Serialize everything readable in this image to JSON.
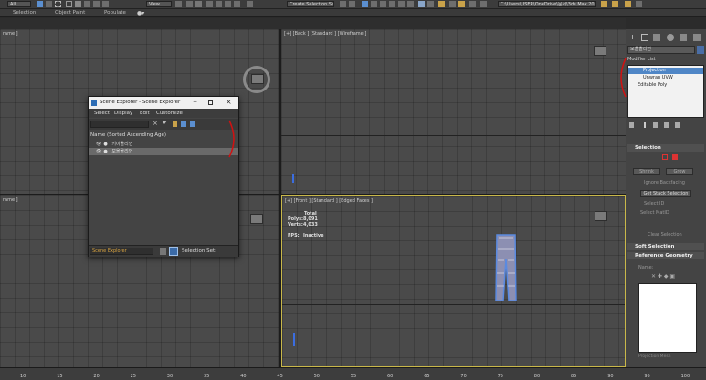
{
  "toolbar": {
    "all_dropdown": "All",
    "view_dropdown": "View",
    "selection_set_dropdown": "Create Selection Se",
    "project_path": "C:\\Users\\USER\\OneDrive\\문서\\3ds Max 2022"
  },
  "ribbon": {
    "tabs": [
      "Selection",
      "Object Paint",
      "Populate"
    ]
  },
  "viewports": {
    "top_left_label": "rame ]",
    "top_right_label": "[+] [Back ] [Standard ] [Wireframe ]",
    "bottom_left_label": "rame ]",
    "bottom_right_label": "[+] [Front ] [Standard ] [Edged Faces ]",
    "stats": {
      "total_label": "Total",
      "polys_label": "Polys:",
      "polys_value": "8,091",
      "verts_label": "Verts:",
      "verts_value": "4,033",
      "fps_label": "FPS:",
      "fps_value": "Inactive"
    }
  },
  "scene_explorer": {
    "title": "Scene Explorer - Scene Explorer",
    "menus": [
      "Select",
      "Display",
      "Edit",
      "Customize"
    ],
    "column_header": "Name (Sorted Ascending Age)",
    "rows": [
      {
        "label": "키이올리언"
      },
      {
        "label": "모올올리언"
      }
    ],
    "explorer_dropdown": "Scene Explorer",
    "selection_set_label": "Selection Set:"
  },
  "command_panel": {
    "object_name": "모올올리언",
    "modifier_list_label": "Modifier List",
    "modifier_stack": [
      {
        "label": "Projection",
        "selected": true
      },
      {
        "label": "Unwrap UVW",
        "selected": false
      },
      {
        "label": "Editable Poly",
        "selected": false
      }
    ],
    "selection_rollout": "Selection",
    "shrink_label": "Shrink",
    "grow_label": "Grow",
    "ignore_backfacing_label": "Ignore Backfacing",
    "get_stack_selection_label": "Get Stack Selection",
    "select_id_label": "Select ID",
    "select_matid_label": "Select MatID",
    "clear_selection_label": "Clear Selection",
    "soft_selection_rollout": "Soft Selection",
    "reference_geometry_rollout": "Reference Geometry",
    "name_label": "Name:",
    "projection_mesh_label": "Projection Mesh"
  },
  "timeline": {
    "ticks": [
      "10",
      "15",
      "20",
      "25",
      "30",
      "35",
      "40",
      "45",
      "50",
      "55",
      "60",
      "65",
      "70",
      "75",
      "80",
      "85",
      "90",
      "95",
      "100"
    ]
  },
  "colors": {
    "viewport_bg": "#4a4a4a",
    "active_viewport_border": "#c9b84a",
    "selection_highlight": "#4f86c6",
    "annotation_red": "#d11111"
  }
}
